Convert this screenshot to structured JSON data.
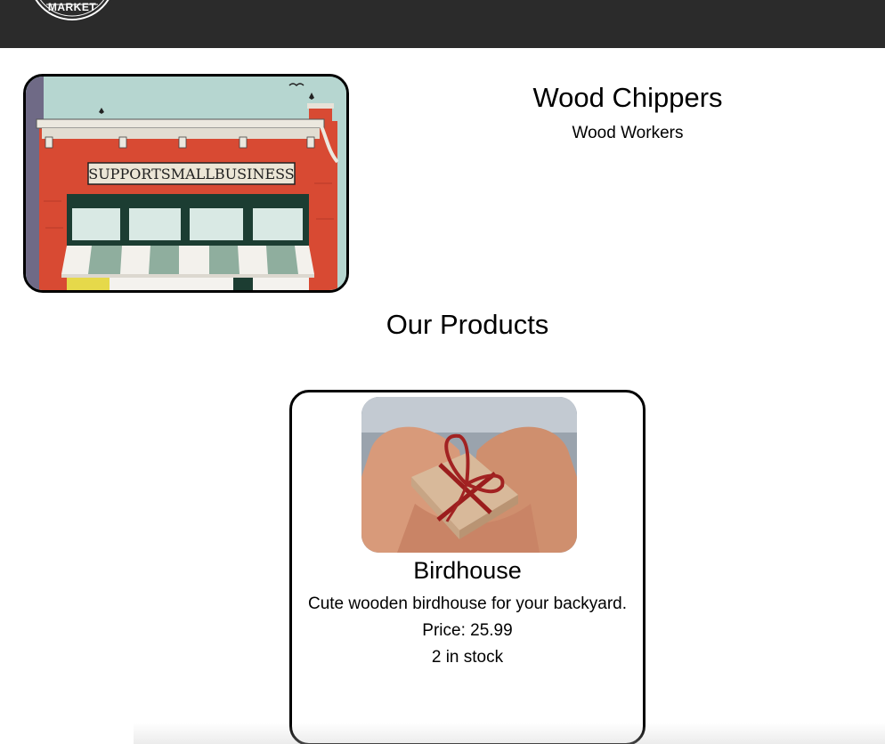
{
  "header": {
    "logo_text": "MARKET",
    "background_color": "#2b2b2b"
  },
  "store": {
    "name": "Wood Chippers",
    "category": "Wood Workers",
    "image": {
      "sign_text": "SUPPORTSMALLBUSINESS"
    }
  },
  "products_section": {
    "heading": "Our Products",
    "products": [
      {
        "name": "Birdhouse",
        "description": "Cute wooden birdhouse for your backyard.",
        "price": "Price: 25.99",
        "stock": "2 in stock"
      }
    ]
  }
}
